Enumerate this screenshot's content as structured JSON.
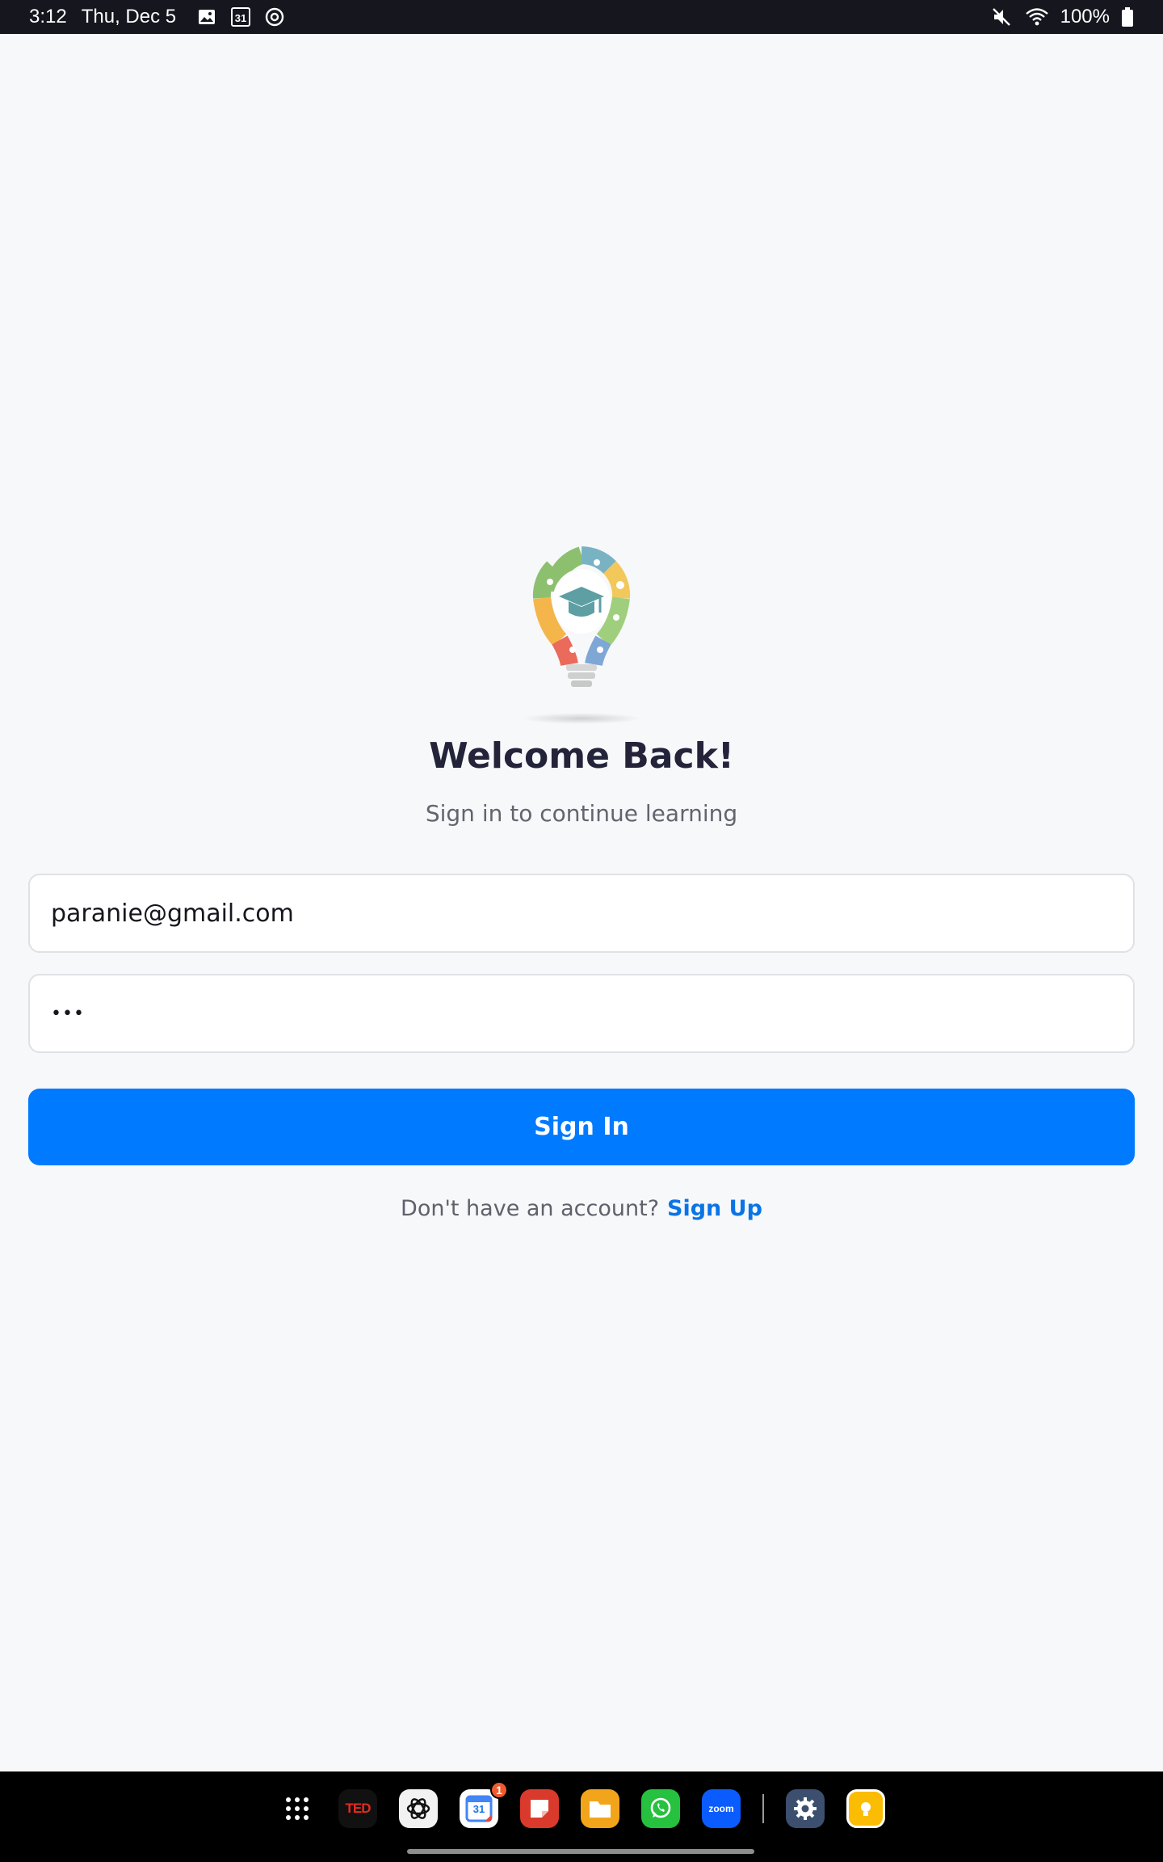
{
  "status_bar": {
    "time": "3:12",
    "date": "Thu, Dec 5",
    "left_icons": [
      "image-icon",
      "calendar-icon",
      "sync-icon"
    ],
    "right_icons": [
      "mute-icon",
      "wifi-icon"
    ],
    "battery": "100%"
  },
  "login": {
    "logo_icon": "lightbulb-graduation-cap-logo",
    "title": "Welcome Back!",
    "subtitle": "Sign in to continue learning",
    "email_value": "paranie@gmail.com",
    "password_value": "•••",
    "signin_label": "Sign In",
    "signup_prompt": "Don't have an account?",
    "signup_link": "Sign Up",
    "colors": {
      "primary": "#007aff",
      "link": "#0a74e6",
      "title": "#23233a"
    }
  },
  "dock": {
    "apps": [
      {
        "name": "app-drawer-icon"
      },
      {
        "name": "ted-icon",
        "label": "TED"
      },
      {
        "name": "chatgpt-icon"
      },
      {
        "name": "calendar-app-icon",
        "label": "31",
        "badge": "1"
      },
      {
        "name": "notes-app-icon"
      },
      {
        "name": "files-app-icon"
      },
      {
        "name": "whatsapp-icon"
      },
      {
        "name": "zoom-icon",
        "label": "zoom"
      },
      {
        "name": "settings-icon"
      },
      {
        "name": "keep-icon"
      }
    ]
  }
}
